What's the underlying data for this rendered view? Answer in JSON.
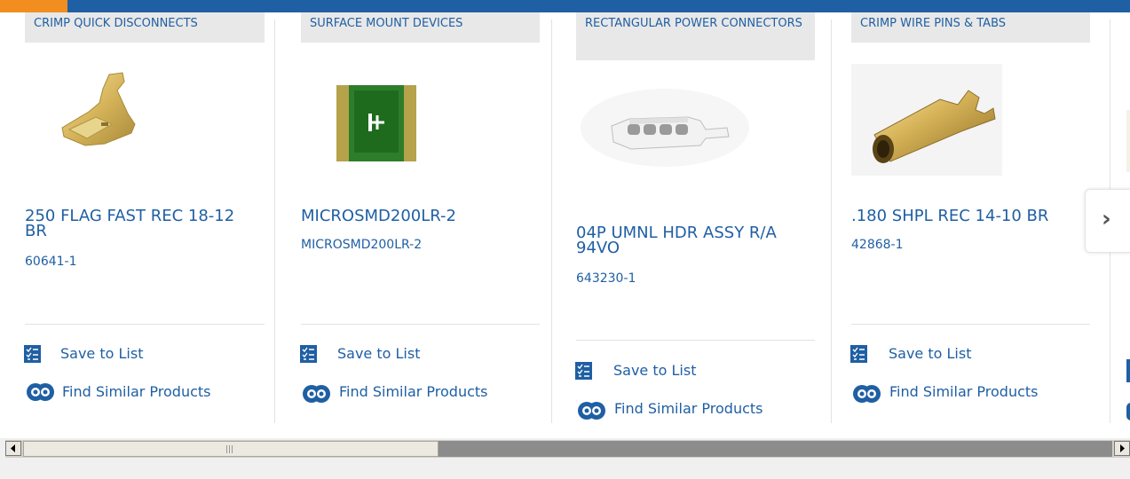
{
  "colors": {
    "accent_blue": "#1f5fa3",
    "accent_orange": "#f28d1f",
    "category_bg": "#e8e8e8"
  },
  "cards": [
    {
      "category": "CRIMP QUICK DISCONNECTS",
      "title": "250 FLAG FAST REC 18-12 BR",
      "part_number": "60641-1",
      "image": "flag-terminal-product-image",
      "save_label": "Save to List",
      "similar_label": "Find Similar Products"
    },
    {
      "category": "SURFACE MOUNT DEVICES",
      "title": "MICROSMD200LR-2",
      "part_number": "MICROSMD200LR-2",
      "image": "smd-fuse-product-image",
      "save_label": "Save to List",
      "similar_label": "Find Similar Products"
    },
    {
      "category": "RECTANGULAR POWER CONNECTORS",
      "title": "04P UMNL HDR ASSY R/A 94VO",
      "part_number": "643230-1",
      "image": "header-connector-product-image",
      "save_label": "Save to List",
      "similar_label": "Find Similar Products"
    },
    {
      "category": "CRIMP WIRE PINS & TABS",
      "title": ".180 SHPL REC 14-10 BR",
      "part_number": "42868-1",
      "image": "crimp-pin-product-image",
      "save_label": "Save to List",
      "similar_label": "Find Similar Products"
    }
  ],
  "carousel": {
    "next_icon": "chevron-right-icon"
  },
  "scrollbar": {
    "position_fraction": 0.0,
    "visible_fraction": 0.38
  }
}
